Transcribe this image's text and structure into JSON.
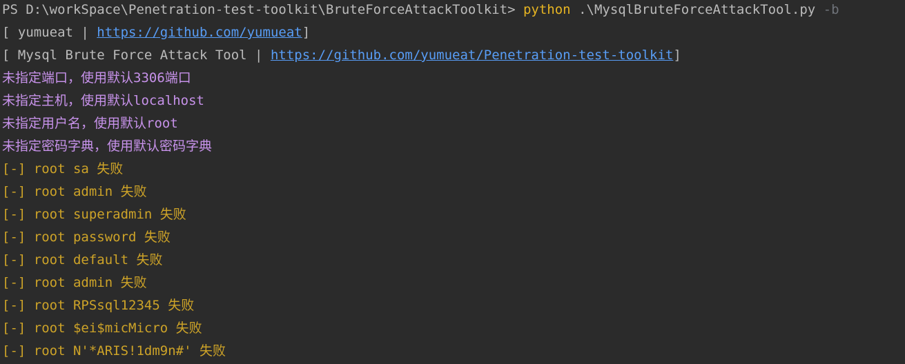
{
  "colors": {
    "background": "#2b2b2b",
    "default_text": "#bbbbbb",
    "python_keyword": "#e6b422",
    "flag": "#6f737a",
    "link": "#589df6",
    "info": "#c792ea",
    "fail": "#cda328"
  },
  "command": {
    "prompt": "PS D:\\workSpace\\Penetration-test-toolkit\\BruteForceAttackToolkit> ",
    "program": "python",
    "script": " .\\MysqlBruteForceAttackTool.py ",
    "flag": "-b"
  },
  "banner": {
    "line1_prefix": "[ yumueat | ",
    "line1_link": "https://github.com/yumueat",
    "line1_suffix": "]",
    "line2_prefix": "[ Mysql Brute Force Attack Tool | ",
    "line2_link": "https://github.com/yumueat/Penetration-test-toolkit",
    "line2_suffix": "]"
  },
  "info_messages": [
    "未指定端口，使用默认3306端口",
    "未指定主机，使用默认localhost",
    "未指定用户名，使用默认root",
    "未指定密码字典，使用默认密码字典"
  ],
  "attempts": [
    "[-] root sa 失败",
    "[-] root admin 失败",
    "[-] root superadmin 失败",
    "[-] root password 失败",
    "[-] root default 失败",
    "[-] root admin 失败",
    "[-] root RPSsql12345 失败",
    "[-] root $ei$micMicro 失败",
    "[-] root N'*ARIS!1dm9n#' 失败"
  ]
}
